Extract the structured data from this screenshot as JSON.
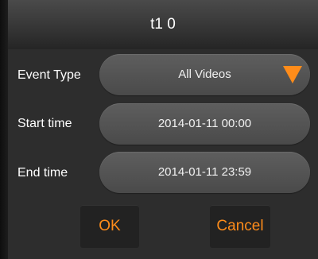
{
  "dialog": {
    "title": "t1 0"
  },
  "fields": {
    "event_type": {
      "label": "Event Type",
      "value": "All Videos",
      "arrow_icon": "triangle-down-icon",
      "arrow_color": "#ff8c1a"
    },
    "start_time": {
      "label": "Start time",
      "value": "2014-01-11 00:00"
    },
    "end_time": {
      "label": "End time",
      "value": "2014-01-11 23:59"
    }
  },
  "buttons": {
    "ok_label": "OK",
    "cancel_label": "Cancel",
    "accent_color": "#ff8c1a"
  }
}
